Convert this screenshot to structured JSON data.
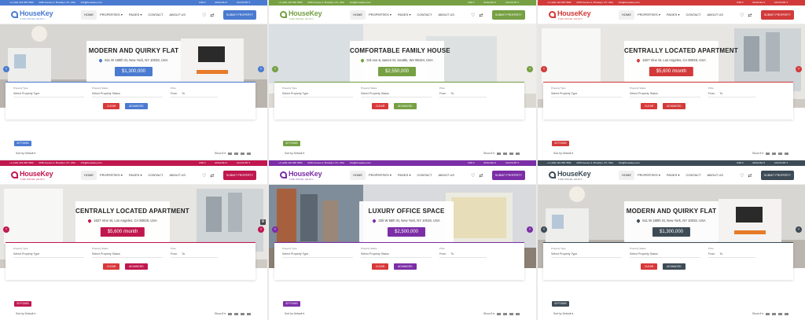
{
  "common": {
    "phone": "+1 (123) 123 456 7890",
    "address": "2150 Avenue 2, Brooklyn, NY, USA",
    "email": "info@housekey.com",
    "currency": "USD ▾",
    "language": "ENGLISH ▾",
    "account": "ACCOUNT ▾",
    "logo_text": "HouseKey",
    "logo_tagline": "FIND HOUSE. ENJOY!",
    "menu": [
      "HOME",
      "PROPERTIES ▾",
      "PAGES ▾",
      "CONTACT",
      "ABOUT US"
    ],
    "submit_label": "SUBMIT PROPERTY",
    "prev_arrow": "‹",
    "next_arrow": "›",
    "field_type_label": "Property Type",
    "field_type_value": "Select Property Type",
    "field_status_label": "Property Status",
    "field_status_value": "Select Property Status",
    "field_price_label": "Price",
    "field_price_from": "From",
    "field_price_to": "To",
    "clear_label": "CLEAR",
    "advanced_label": "ADVANCED",
    "found_label": "32 FOUND",
    "sort_label": "Sort by Default ▾",
    "show_label": "Show 8 ▾",
    "heart_icon": "♡",
    "compare_icon": "⇄"
  },
  "panels": [
    {
      "title": "MODERN AND QUIRKY FLAT",
      "address": "611 W 180th St, New York, NY 10033, USA",
      "price": "$1,300,000",
      "color": "#4a7bd0",
      "scene": "living"
    },
    {
      "title": "COMFORTABLE FAMILY HOUSE",
      "address": "3rd Ave & James St, Seattle, WA 98104, USA",
      "price": "$2,550,000",
      "color": "#76a043",
      "scene": "bedroom"
    },
    {
      "title": "CENTRALLY LOCATED APARTMENT",
      "address": "1627 Vine St, Los Angeles, CA 90028, USA",
      "price": "$5,600 /month",
      "color": "#d23a3a",
      "scene": "dining"
    },
    {
      "title": "CENTRALLY LOCATED APARTMENT",
      "address": "1627 Vine St, Los Angeles, CA 90028, USA",
      "price": "$5,600 /month",
      "color": "#c0174f",
      "scene": "dining"
    },
    {
      "title": "LUXURY OFFICE SPACE",
      "address": "230 W 55th St, New York, NY 10019, USA",
      "price": "$2,500,000",
      "color": "#7b2ea6",
      "scene": "office"
    },
    {
      "title": "MODERN AND QUIRKY FLAT",
      "address": "611 W 180th St, New York, NY 10033, USA",
      "price": "$1,300,000",
      "color": "#3d4b56",
      "scene": "living"
    }
  ]
}
